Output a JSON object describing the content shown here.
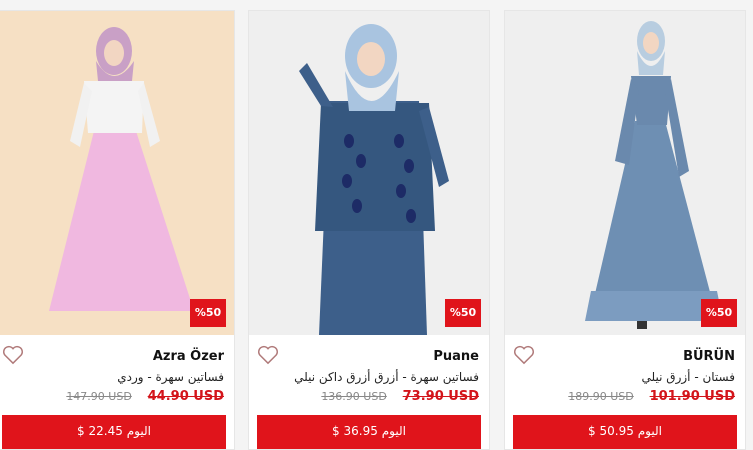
{
  "colors": {
    "accent": "#e0141b",
    "page_bg": "#f4f4f4"
  },
  "products": [
    {
      "brand": "Azra Özer",
      "name": "فساتين سهرة - وردي",
      "old_price": "147.90 USD",
      "new_price": "44.90 USD",
      "discount": "%50",
      "today_label": "اليوم",
      "today_price": "$ 22.45",
      "favorite_icon": "heart-icon"
    },
    {
      "brand": "Puane",
      "name": "فساتين سهرة - أزرق أزرق داكن نيلي",
      "old_price": "136.90 USD",
      "new_price": "73.90 USD",
      "discount": "%50",
      "today_label": "اليوم",
      "today_price": "$ 36.95",
      "favorite_icon": "heart-icon"
    },
    {
      "brand": "BÜRÜN",
      "name": "فستان - أزرق نيلي",
      "old_price": "189.90 USD",
      "new_price": "101.90 USD",
      "discount": "%50",
      "today_label": "اليوم",
      "today_price": "$ 50.95",
      "favorite_icon": "heart-icon"
    }
  ]
}
